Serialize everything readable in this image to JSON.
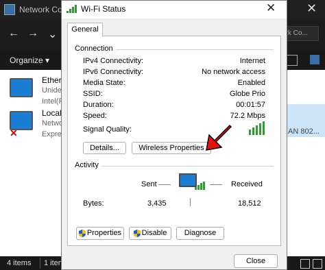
{
  "background_window": {
    "title": "Network Conn",
    "search_placeholder": "ork Co...",
    "toolbar": {
      "organize": "Organize ▾"
    },
    "items": [
      {
        "name": "Etherr",
        "sub1": "Unide",
        "sub2": "Intel(R"
      },
      {
        "name": "Local",
        "sub1": "Netwo",
        "sub2": "Expres"
      }
    ],
    "right_text": "AN 802...",
    "status": {
      "count": "4 items",
      "selected": "1 iten"
    }
  },
  "dialog": {
    "title": "Wi-Fi Status",
    "tab": "General",
    "connection": {
      "label": "Connection",
      "rows": [
        {
          "label": "IPv4 Connectivity:",
          "value": "Internet"
        },
        {
          "label": "IPv6 Connectivity:",
          "value": "No network access"
        },
        {
          "label": "Media State:",
          "value": "Enabled"
        },
        {
          "label": "SSID:",
          "value": "Globe Prio"
        },
        {
          "label": "Duration:",
          "value": "00:01:57"
        },
        {
          "label": "Speed:",
          "value": "72.2 Mbps"
        }
      ],
      "signal_label": "Signal Quality:",
      "signal_bars": 5,
      "details_button": "Details...",
      "wireless_button": "Wireless Properties"
    },
    "activity": {
      "label": "Activity",
      "sent_label": "Sent",
      "received_label": "Received",
      "bytes_label": "Bytes:",
      "bytes_sent": "3,435",
      "bytes_received": "18,512"
    },
    "buttons": {
      "properties": "Properties",
      "disable": "Disable",
      "diagnose": "Diagnose",
      "close": "Close"
    },
    "colors": {
      "signal": "#2e9e2e",
      "arrow": "#e81010",
      "accent": "#1a7fd4"
    }
  }
}
